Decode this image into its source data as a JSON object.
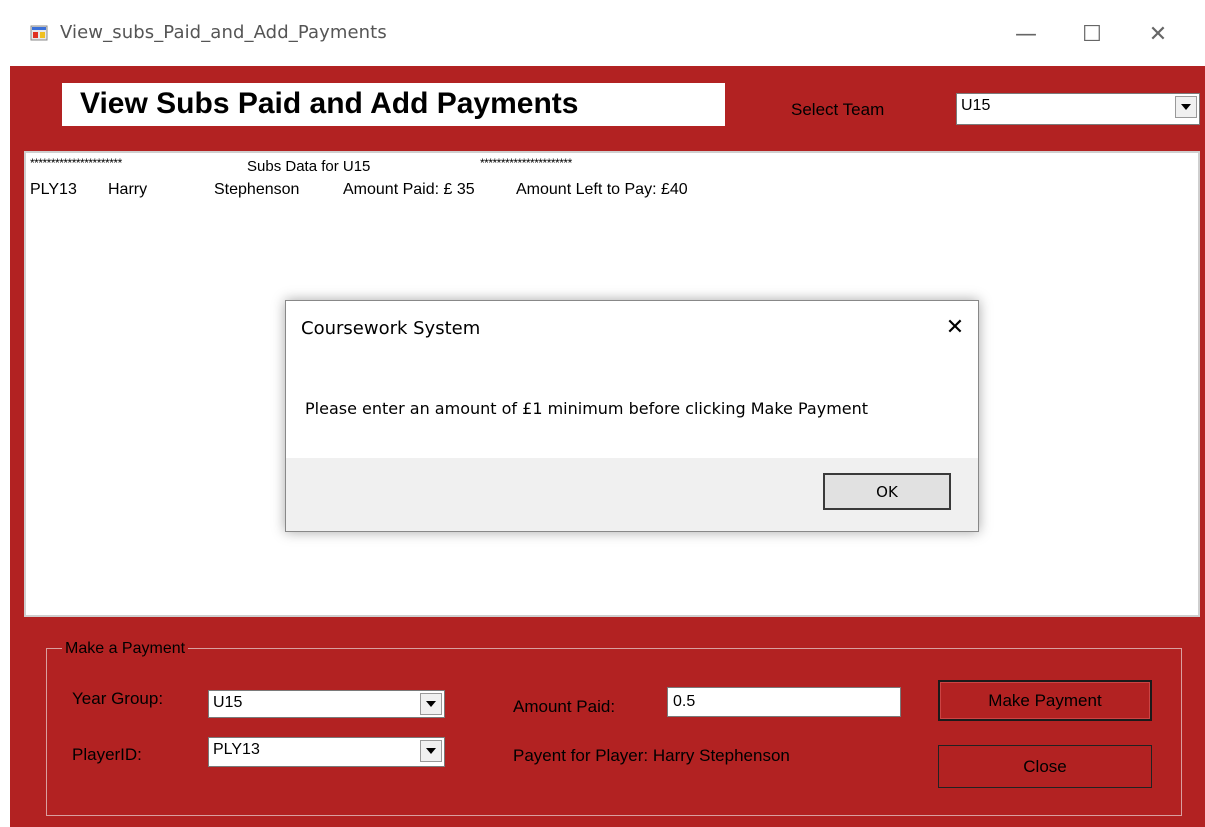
{
  "window": {
    "title": "View_subs_Paid_and_Add_Payments",
    "minimize_glyph": "—",
    "maximize_glyph": "☐",
    "close_glyph": "✕"
  },
  "header": {
    "heading": "View Subs Paid and Add Payments",
    "select_team_label": "Select Team",
    "team_selected": "U15"
  },
  "listbox": {
    "stars_left": "**********************",
    "subs_title": "Subs Data for U15",
    "stars_right": "**********************",
    "rows": [
      {
        "id": "PLY13",
        "first": "Harry",
        "last": "Stephenson",
        "paid": "Amount Paid: £ 35",
        "left": "Amount Left to Pay: £40"
      }
    ]
  },
  "payment": {
    "group_title": "Make a Payment",
    "year_group_label": "Year Group:",
    "year_group_value": "U15",
    "player_id_label": "PlayerID:",
    "player_id_value": "PLY13",
    "amount_label": "Amount Paid:",
    "amount_value": "0.5",
    "payment_for": "Payent for Player: Harry Stephenson",
    "make_payment_button": "Make Payment",
    "close_button": "Close"
  },
  "dialog": {
    "title": "Coursework System",
    "close_glyph": "✕",
    "message": "Please enter an amount of £1 minimum before clicking Make Payment",
    "ok_button": "OK"
  },
  "colors": {
    "form_background": "#b22222",
    "dialog_footer": "#f0f0f0"
  }
}
